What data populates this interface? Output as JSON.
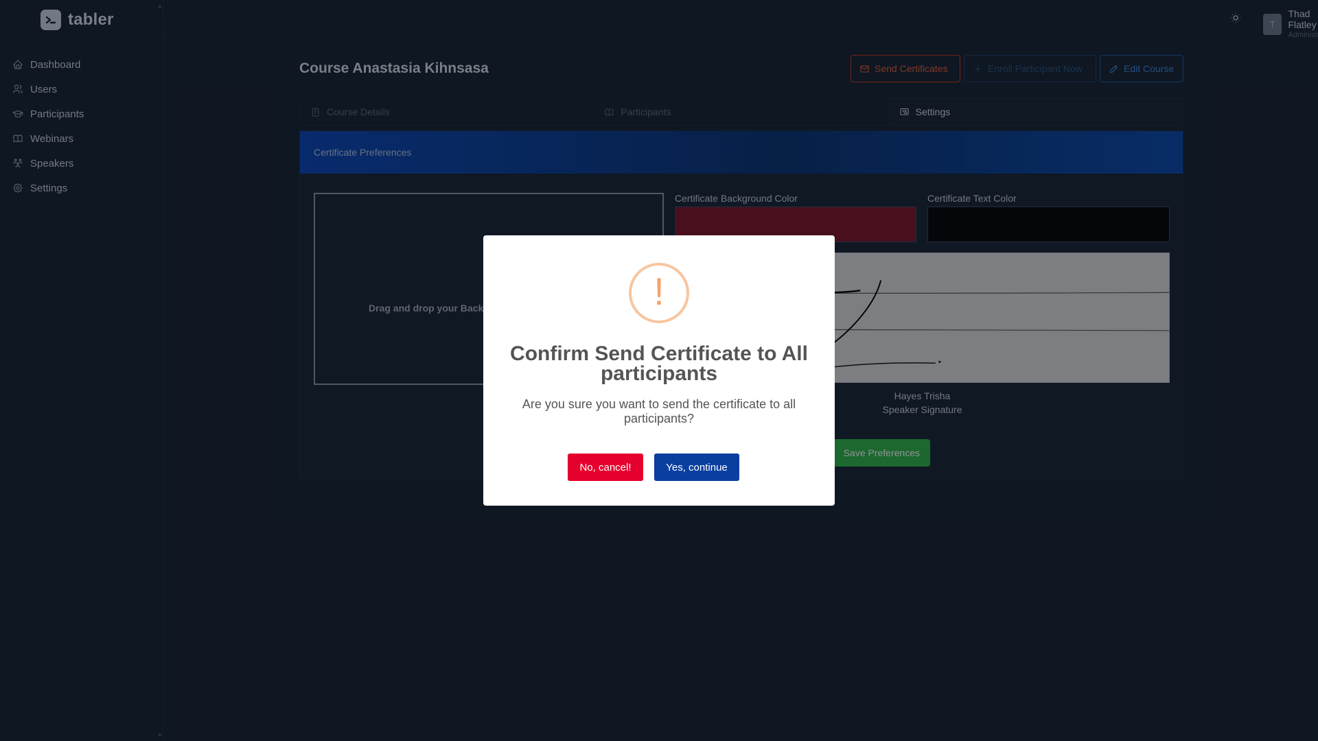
{
  "brand": {
    "name": "tabler",
    "logo_icon": "terminal-icon"
  },
  "sidebar": {
    "items": [
      {
        "label": "Dashboard",
        "icon": "home-icon"
      },
      {
        "label": "Users",
        "icon": "users-icon"
      },
      {
        "label": "Participants",
        "icon": "school-icon"
      },
      {
        "label": "Webinars",
        "icon": "book-icon"
      },
      {
        "label": "Speakers",
        "icon": "speakers-icon"
      },
      {
        "label": "Settings",
        "icon": "gear-icon"
      }
    ]
  },
  "topbar": {
    "theme_icon": "sun-icon",
    "user": {
      "initial": "T",
      "name": "Thad Flatley",
      "role": "Administrator"
    }
  },
  "page": {
    "title": "Course Anastasia Kihnsasa",
    "buttons": {
      "send": "Send Certificates",
      "enroll": "Enroll Participant Now",
      "edit": "Edit Course"
    },
    "tabs": [
      {
        "label": "Course Details",
        "icon": "file-icon",
        "active": false
      },
      {
        "label": "Participants",
        "icon": "book-icon",
        "active": false
      },
      {
        "label": "Settings",
        "icon": "certificate-icon",
        "active": true
      }
    ]
  },
  "certificate": {
    "header": "Certificate Preferences",
    "dropzone_text": "Drag and drop your Background image here",
    "bg_color_label": "Certificate Background Color",
    "bg_color": "#7c1224",
    "text_color_label": "Certificate Text Color",
    "text_color": "#000000",
    "speaker_name": "Hayes Trisha",
    "speaker_role": "Speaker Signature",
    "save_label": "Save Preferences"
  },
  "modal": {
    "icon": "exclamation-icon",
    "title": "Confirm Send Certificate to All participants",
    "text": "Are you sure you want to send the certificate to all participants?",
    "cancel_label": "No, cancel!",
    "confirm_label": "Yes, continue"
  },
  "colors": {
    "accent_danger": "#e6002e",
    "accent_primary": "#0a3fa0",
    "warning_icon": "#f8c59f",
    "save_green": "#2fb344"
  }
}
